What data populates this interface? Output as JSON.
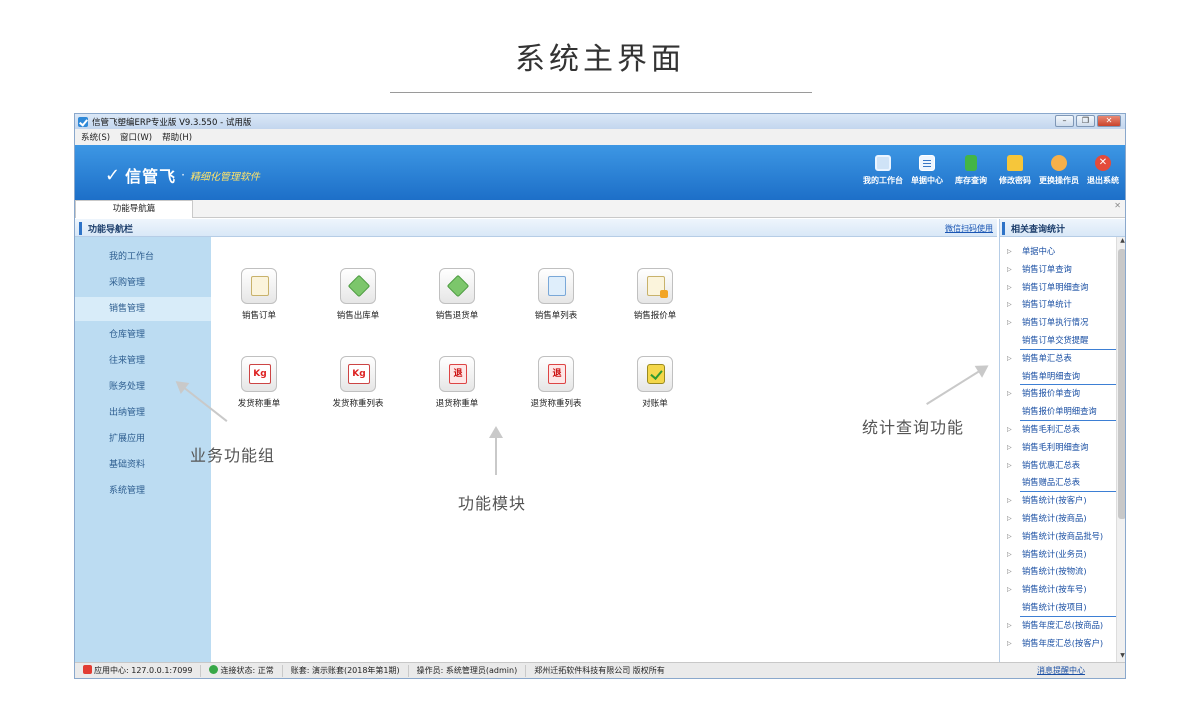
{
  "page_title": "系统主界面",
  "window": {
    "title": "信管飞塑编ERP专业版 V9.3.550 - 试用版",
    "menu": [
      "系统(S)",
      "窗口(W)",
      "帮助(H)"
    ]
  },
  "banner": {
    "logo_name": "信管飞",
    "slogan": "精细化管理软件",
    "tools": [
      {
        "label": "我的工作台",
        "icon": "monitor-icon"
      },
      {
        "label": "单据中心",
        "icon": "document-icon"
      },
      {
        "label": "库存查询",
        "icon": "box-icon"
      },
      {
        "label": "修改密码",
        "icon": "lock-icon"
      },
      {
        "label": "更换操作员",
        "icon": "user-icon"
      },
      {
        "label": "退出系统",
        "icon": "exit-icon"
      }
    ]
  },
  "tab": {
    "label": "功能导航篇"
  },
  "nav": {
    "header": "功能导航栏",
    "wechat_link": "微信扫码使用",
    "items": [
      "我的工作台",
      "采购管理",
      "销售管理",
      "仓库管理",
      "往来管理",
      "账务处理",
      "出纳管理",
      "扩展应用",
      "基础资料",
      "系统管理"
    ],
    "active": "销售管理"
  },
  "modules": [
    {
      "label": "销售订单",
      "icon": "sales-order-icon"
    },
    {
      "label": "销售出库单",
      "icon": "outbound-icon"
    },
    {
      "label": "销售退货单",
      "icon": "return-icon"
    },
    {
      "label": "销售单列表",
      "icon": "list-icon"
    },
    {
      "label": "销售报价单",
      "icon": "quote-icon"
    },
    {
      "label": "发货称重单",
      "icon": "weigh-icon",
      "glyph": "Kg"
    },
    {
      "label": "发货称重列表",
      "icon": "weigh-list-icon",
      "glyph": "Kg"
    },
    {
      "label": "退货称重单",
      "icon": "return-weigh-icon",
      "glyph": "退"
    },
    {
      "label": "退货称重列表",
      "icon": "return-weigh-list-icon",
      "glyph": "退"
    },
    {
      "label": "对账单",
      "icon": "statement-icon"
    }
  ],
  "stats": {
    "header": "相关查询统计",
    "items": [
      "单据中心",
      "销售订单查询",
      "销售订单明细查询",
      "销售订单统计",
      "销售订单执行情况",
      "销售订单交货提醒",
      "销售单汇总表",
      "销售单明细查询",
      "销售报价单查询",
      "销售报价单明细查询",
      "销售毛利汇总表",
      "销售毛利明细查询",
      "销售优惠汇总表",
      "销售赠品汇总表",
      "销售统计(按客户)",
      "销售统计(按商品)",
      "销售统计(按商品批号)",
      "销售统计(业务员)",
      "销售统计(按物流)",
      "销售统计(按车号)",
      "销售统计(按项目)",
      "销售年度汇总(按商品)",
      "销售年度汇总(按客户)"
    ]
  },
  "status": {
    "app_center": "应用中心: 127.0.0.1:7099",
    "connection": "连接状态: 正常",
    "account": "账套: 演示账套(2018年第1期)",
    "operator": "操作员: 系统管理员(admin)",
    "company": "郑州迁拓软件科技有限公司 版权所有",
    "message_center": "消息提醒中心"
  },
  "annotations": {
    "business_group": "业务功能组",
    "modules": "功能模块",
    "stats": "统计查询功能"
  },
  "colors": {
    "accent": "#1d6fc8",
    "sidebar": "#bcdcf2",
    "link": "#1a4fa3"
  }
}
